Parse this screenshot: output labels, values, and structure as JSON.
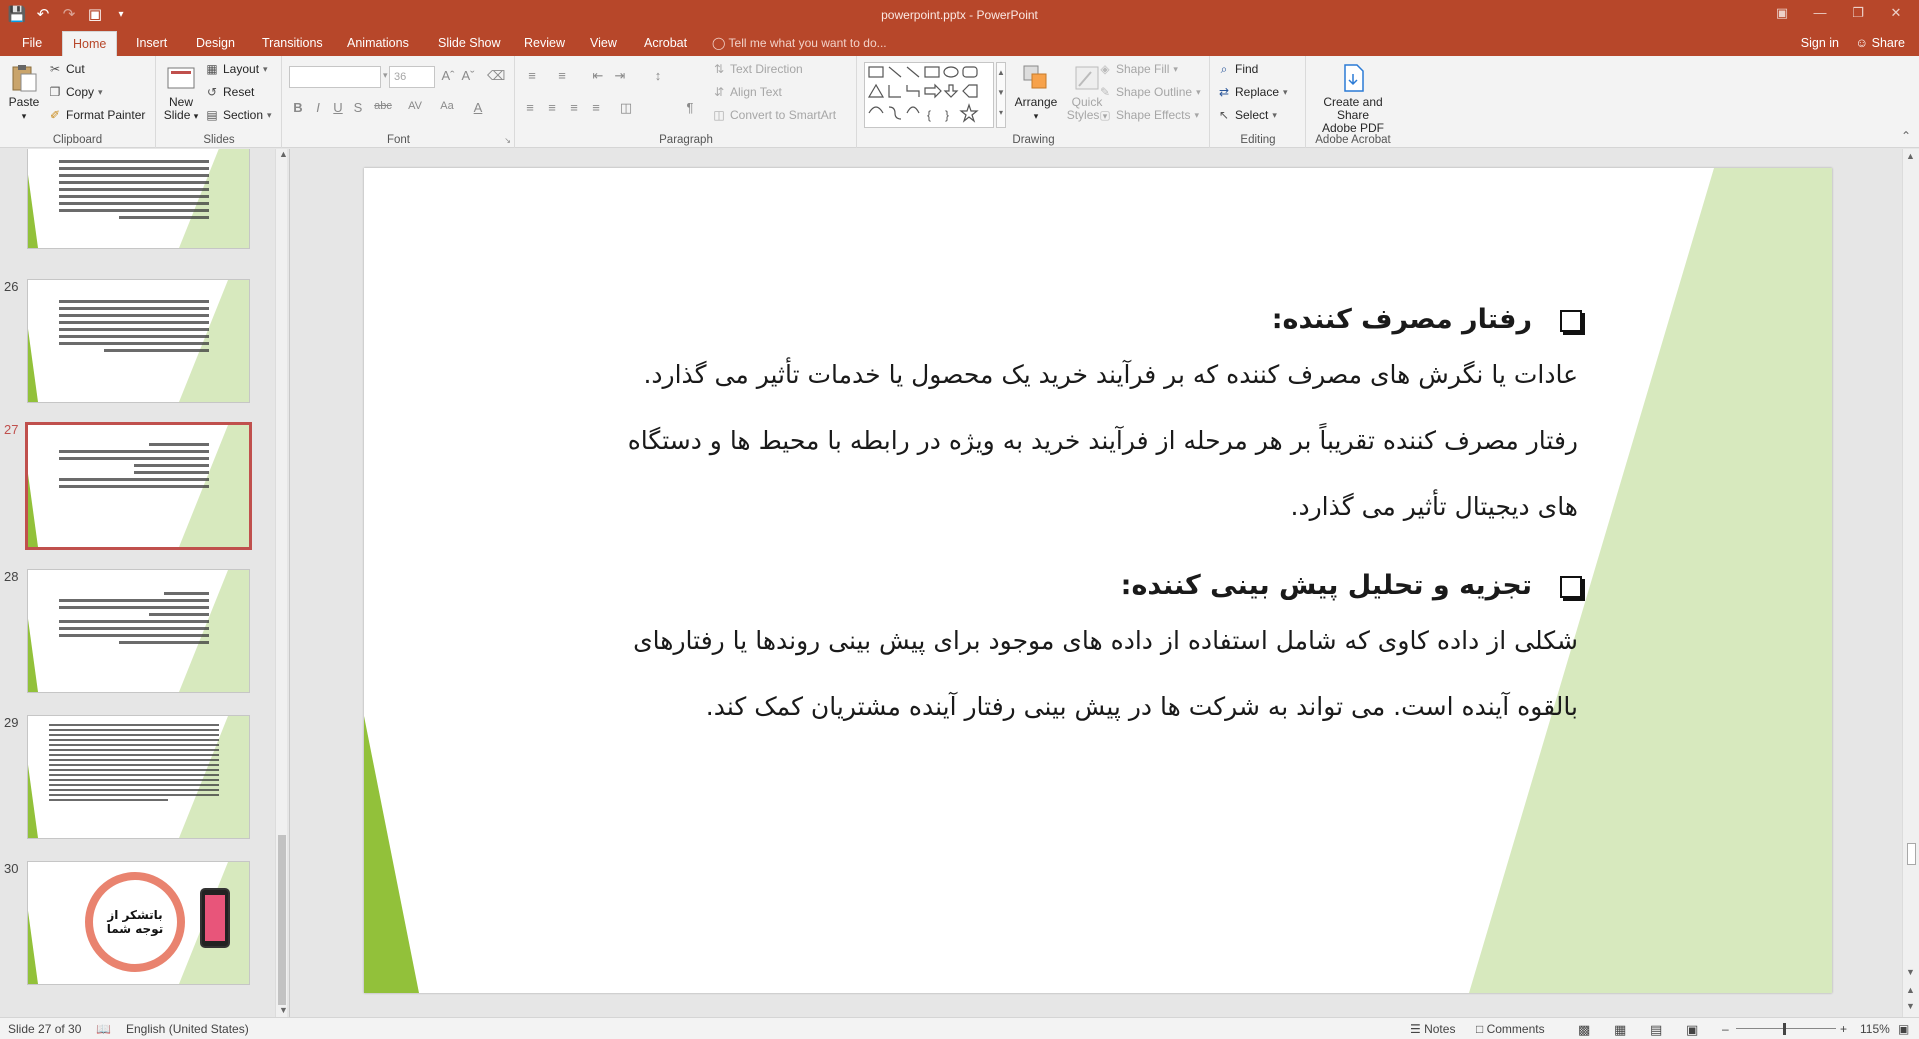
{
  "window": {
    "title": "powerpoint.pptx - PowerPoint",
    "controls": [
      "restore-icon",
      "minimize-icon",
      "maximize-icon",
      "close-icon"
    ]
  },
  "qat": {
    "icons": [
      "save-icon",
      "undo-icon",
      "redo-icon",
      "present-icon",
      "customize-icon"
    ]
  },
  "tabs": [
    "File",
    "Home",
    "Insert",
    "Design",
    "Transitions",
    "Animations",
    "Slide Show",
    "Review",
    "View",
    "Acrobat"
  ],
  "active_tab": "Home",
  "tell_me": "Tell me what you want to do...",
  "sign_in": "Sign in",
  "share": "Share",
  "ribbon": {
    "clipboard": {
      "label": "Clipboard",
      "paste": "Paste",
      "cut": "Cut",
      "copy": "Copy",
      "format_painter": "Format Painter"
    },
    "slides": {
      "label": "Slides",
      "new_slide": "New",
      "new_slide2": "Slide",
      "layout": "Layout",
      "reset": "Reset",
      "section": "Section"
    },
    "font": {
      "label": "Font",
      "font_name": "",
      "font_size": "36",
      "bold": "B",
      "italic": "I",
      "underline": "U",
      "shadow": "S",
      "strike": "abc",
      "spacing": "AV",
      "case": "Aa",
      "color": "A"
    },
    "paragraph": {
      "label": "Paragraph",
      "text_direction": "Text Direction",
      "align_text": "Align Text",
      "smartart": "Convert to SmartArt"
    },
    "drawing": {
      "label": "Drawing",
      "arrange": "Arrange",
      "quick_styles": "Quick",
      "quick_styles2": "Styles",
      "shape_fill": "Shape Fill",
      "shape_outline": "Shape Outline",
      "shape_effects": "Shape Effects"
    },
    "editing": {
      "label": "Editing",
      "find": "Find",
      "replace": "Replace",
      "select": "Select"
    },
    "acrobat": {
      "label": "Adobe Acrobat",
      "create_share": "Create and Share",
      "create_share2": "Adobe PDF"
    }
  },
  "thumbnails": [
    {
      "number": "",
      "selected": false
    },
    {
      "number": "26",
      "selected": false
    },
    {
      "number": "27",
      "selected": true
    },
    {
      "number": "28",
      "selected": false
    },
    {
      "number": "29",
      "selected": false
    },
    {
      "number": "30",
      "selected": false
    }
  ],
  "slide": {
    "heading1": "رفتار مصرف کننده:",
    "para1_line1": "عادات یا نگرش های مصرف کننده که بر فرآیند خرید یک محصول یا خدمات تأثیر می گذارد.",
    "para1_line2": "رفتار مصرف کننده تقریباً بر هر مرحله از فرآیند خرید به ویژه در رابطه با محیط ها و دستگاه",
    "para1_line3": "های دیجیتال تأثیر می گذارد.",
    "heading2": "تجزیه و تحلیل پیش بینی کننده:",
    "para2_line1": "شکلی از داده کاوی که شامل استفاده از داده های موجود برای پیش بینی روندها یا رفتارهای",
    "para2_line2": "بالقوه آینده است. می تواند به شرکت ها در پیش بینی رفتار آینده مشتریان کمک کند.",
    "thumb30_logo": "باتشکر از توجه شما"
  },
  "status": {
    "slide_counter": "Slide 27 of 30",
    "language": "English (United States)",
    "notes": "Notes",
    "comments": "Comments",
    "zoom": "115%"
  },
  "colors": {
    "accent": "#b7472a",
    "slide_green_light": "#d7e9be",
    "slide_green_dark": "#92c13a",
    "selection": "#c0504d"
  }
}
